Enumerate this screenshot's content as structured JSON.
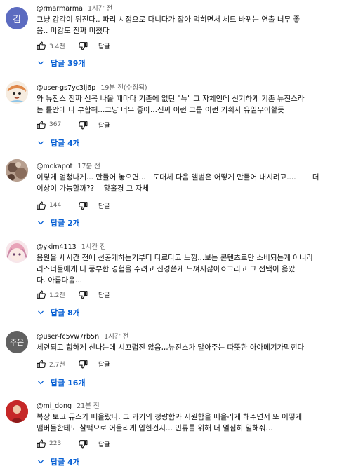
{
  "comments": [
    {
      "avatar": {
        "initial": "김",
        "color": "#5c6bc0"
      },
      "author": "@rmarmarma",
      "time": "1시간 전",
      "text": "그냥 감각이 뒤진다.. 파리 시점으로 다니다가 잡아 먹히면서 세트 바뀌는 연출 너무 좋\n음.. 미감도 진짜 미쳤다",
      "likes": "3.4천",
      "reply_label": "답글",
      "replies_label": "답글 39개"
    },
    {
      "avatar": {
        "initial": "",
        "color": "#e8e8e8"
      },
      "author": "@user-gs7yc3lj6p",
      "time": "19분 전(수정됨)",
      "text": "와 뉴진스 진짜 신곡 나올 때마다 기존에 없던 \"뉴\" 그 자체인데 신기하게 기존 뉴진스라\n는 틀안에 다 부합해...그냥 너무 좋아...진짜 이런 그룹 이런 기획자 유일무이할듯",
      "likes": "367",
      "reply_label": "답글",
      "replies_label": "답글 4개"
    },
    {
      "avatar": {
        "initial": "",
        "color": "#a58d7f"
      },
      "author": "@mokapot",
      "time": "17분 전",
      "text": "이렇게 엄청나게... 만들어 놓으면...   도대체 다음 앨범은 어떻게 만들어 내시려고....       더\n이상이 가능할까??    황홀경 그 자체",
      "likes": "144",
      "reply_label": "답글",
      "replies_label": "답글 2개"
    },
    {
      "avatar": {
        "initial": "",
        "color": "#f3d6de"
      },
      "author": "@ykim4113",
      "time": "1시간 전",
      "text": "음원을 세시간 전에 선공개하는거부터 다르다고 느낌...보는 콘텐츠로만 소비되는게 아니라\n리스너들에게 더 풍부한 경험을 주려고 신경쓴게 느껴지잖아ㅇ그리고 그 선택이 옳았\n다. 아름다움...",
      "likes": "1.2천",
      "reply_label": "답글",
      "replies_label": "답글 8개"
    },
    {
      "avatar": {
        "initial": "주은",
        "color": "#616161"
      },
      "author": "@user-fc5vw7rb5n",
      "time": "1시간 전",
      "text": "세련되고 힙하게 신나는데 시끄럽진 않음,,,뉴진스가 말아주는 따뜻한 아아메기가막힌다",
      "likes": "2.7천",
      "reply_label": "답글",
      "replies_label": "답글 16개"
    },
    {
      "avatar": {
        "initial": "",
        "color": "#d84315"
      },
      "author": "@mi_dong",
      "time": "21분 전",
      "text": "복장 보고 듀스가 떠올랐다. 그 과거의 청량함과 시원함을 떠올리게 해주면서 또 어떻게\n맴버들한테도 찰떡으로 어울리게 입힌건지... 인류를 위해 더 열심히 일해줘...",
      "likes": "223",
      "reply_label": "답글",
      "replies_label": "답글 4개"
    }
  ]
}
